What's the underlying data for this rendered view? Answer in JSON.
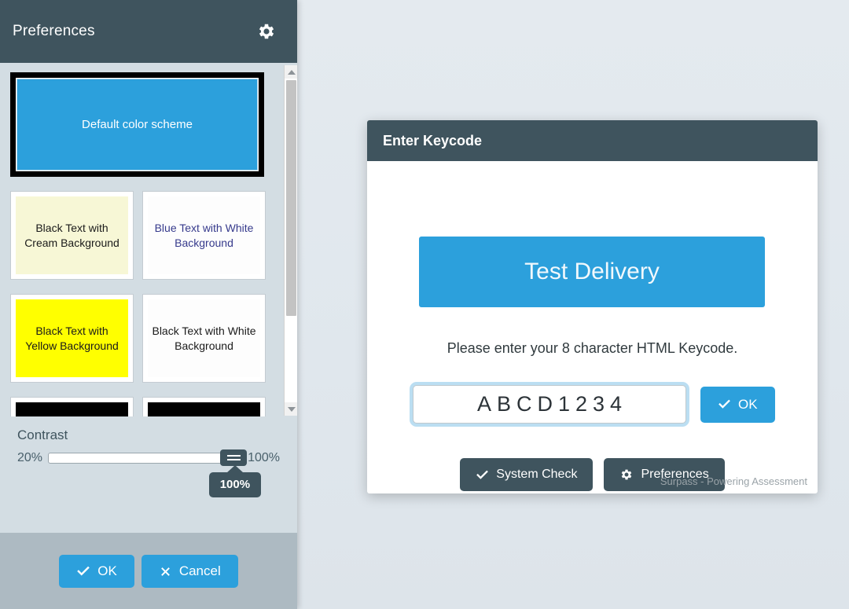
{
  "preferences_panel": {
    "title": "Preferences",
    "gear_icon": "gear-icon",
    "color_schemes": [
      {
        "id": "default",
        "label": "Default color scheme",
        "selected": true,
        "bg": "#2ca0dc",
        "fg": "#ffffff"
      },
      {
        "id": "cream",
        "label": "Black Text with Cream Background",
        "selected": false,
        "bg": "#f7f7d6",
        "fg": "#1a1a1a"
      },
      {
        "id": "blue-white",
        "label": "Blue Text with White Background",
        "selected": false,
        "bg": "#fdfdfd",
        "fg": "#363a8c"
      },
      {
        "id": "yellow",
        "label": "Black Text with Yellow Background",
        "selected": false,
        "bg": "#ffff00",
        "fg": "#1a1a1a"
      },
      {
        "id": "black-white",
        "label": "Black Text with White Background",
        "selected": false,
        "bg": "#fdfdfd",
        "fg": "#1a1a1a"
      },
      {
        "id": "black-left",
        "label": "",
        "selected": false,
        "bg": "#000000",
        "fg": "#ffffff"
      },
      {
        "id": "black-right",
        "label": "",
        "selected": false,
        "bg": "#000000",
        "fg": "#ffffff"
      }
    ],
    "contrast": {
      "label": "Contrast",
      "min_label": "20%",
      "max_label": "100%",
      "value_tooltip": "100%",
      "value": 100
    },
    "footer": {
      "ok_label": "OK",
      "cancel_label": "Cancel"
    }
  },
  "keycode_dialog": {
    "title": "Enter Keycode",
    "banner_text": "Test Delivery",
    "instruction": "Please enter your 8 character HTML Keycode.",
    "keycode_value": "ABCD1234",
    "keycode_placeholder": "",
    "ok_label": "OK",
    "system_check_label": "System Check",
    "preferences_label": "Preferences",
    "footnote": "Surpass - Powering Assessment"
  },
  "colors": {
    "accent_blue": "#2ca0dc",
    "dark_slate": "#3f545e",
    "panel_bg": "#d3dde3",
    "panel_footer": "#adbac2",
    "page_bg": "#e2e8ee"
  }
}
